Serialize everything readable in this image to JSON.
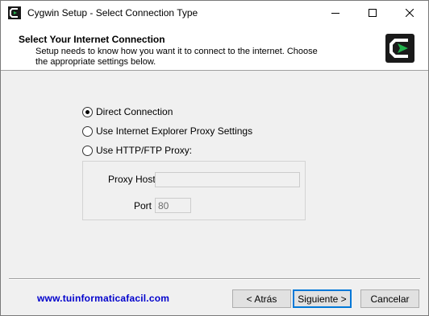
{
  "window": {
    "title": "Cygwin Setup - Select Connection Type"
  },
  "header": {
    "title": "Select Your Internet Connection",
    "description": "Setup needs to know how you want it to connect to the internet.  Choose the appropriate settings below."
  },
  "connection_options": [
    {
      "label": "Direct Connection",
      "selected": true
    },
    {
      "label": "Use Internet Explorer Proxy Settings",
      "selected": false
    },
    {
      "label": "Use HTTP/FTP Proxy:",
      "selected": false
    }
  ],
  "proxy": {
    "host_label": "Proxy Host",
    "host_value": "",
    "port_label": "Port",
    "port_value": "80"
  },
  "footer": {
    "website": "www.tuinformaticafacil.com",
    "back_label": "< Atrás",
    "next_label": "Siguiente >",
    "cancel_label": "Cancelar"
  },
  "icons": {
    "app": "cygwin-icon",
    "logo": "cygwin-logo-icon"
  },
  "colors": {
    "website_link": "#0000cc",
    "default_button_border": "#0078d7",
    "cygwin_green": "#22b14c"
  }
}
